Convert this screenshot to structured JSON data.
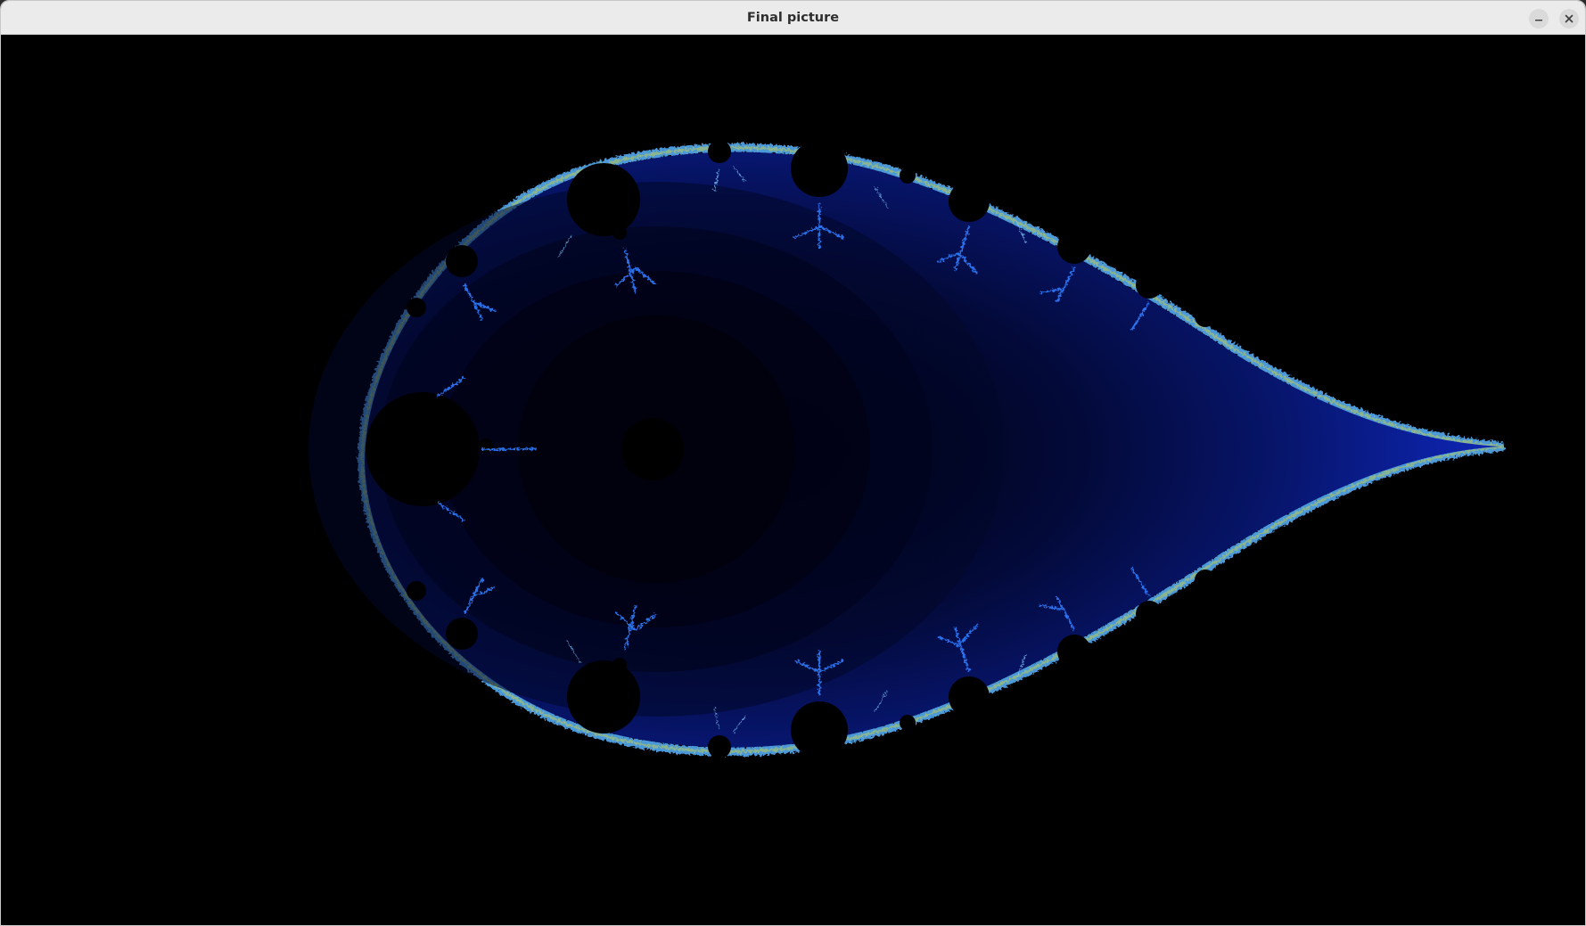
{
  "window": {
    "title": "Final picture",
    "buttons": {
      "minimize_icon": "minimize-icon",
      "close_icon": "close-icon"
    }
  },
  "canvas": {
    "background": "#000000",
    "fractal_colors": {
      "outer_blue": "#1a3bd6",
      "mid_blue": "#0a1a8a",
      "dark_blue": "#02062e",
      "interior": "#000000",
      "edge_cyan": "#4aa8ff",
      "edge_yellow": "#c8d24a"
    }
  }
}
